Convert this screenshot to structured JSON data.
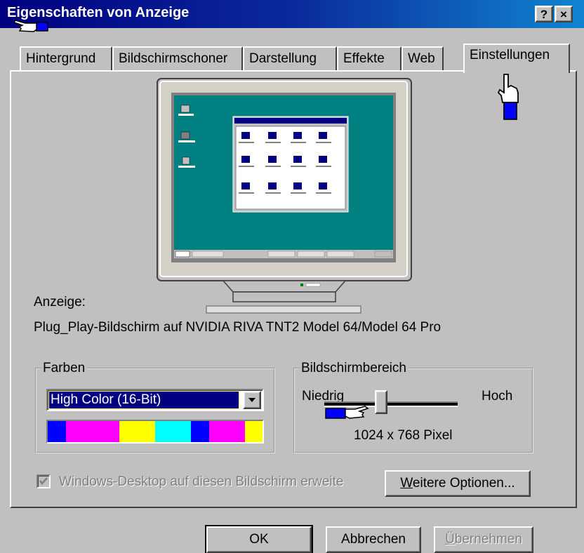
{
  "window": {
    "title": "Eigenschaften von Anzeige",
    "help_button": "?",
    "close_button": "×"
  },
  "tabs": [
    {
      "label": "Hintergrund"
    },
    {
      "label": "Bildschirmschoner"
    },
    {
      "label": "Darstellung"
    },
    {
      "label": "Effekte"
    },
    {
      "label": "Web"
    },
    {
      "label": "Einstellungen",
      "active": true
    }
  ],
  "preview": {
    "desktop_icons": [
      "Arbeitsplatz",
      "Netzwerkumgebung",
      "Papierkorb"
    ]
  },
  "display": {
    "label": "Anzeige:",
    "device": "Plug_Play-Bildschirm auf NVIDIA RIVA TNT2 Model 64/Model 64 Pro"
  },
  "colors": {
    "group_label": "Farben",
    "selected": "High Color (16-Bit)",
    "swatches": [
      "#0000ff",
      "#ff00ff",
      "#ff00ff",
      "#ff00ff",
      "#ffff00",
      "#ffff00",
      "#00ffff",
      "#00ffff",
      "#0000ff",
      "#ff00ff",
      "#ff00ff",
      "#ffff00"
    ]
  },
  "resolution": {
    "group_label": "Bildschirmbereich",
    "low_label": "Niedrig",
    "high_label": "Hoch",
    "value_text": "1024 x 768 Pixel"
  },
  "options": {
    "extend_checkbox_label": "Windows-Desktop auf diesen Bildschirm erweite",
    "extend_checked": true,
    "extend_disabled": true,
    "more_options_accel": "W",
    "more_options_rest": "eitere Optionen..."
  },
  "footer": {
    "ok_label": "OK",
    "cancel_label": "Abbrechen",
    "apply_accel": "Ü",
    "apply_rest": "bernehmen"
  }
}
